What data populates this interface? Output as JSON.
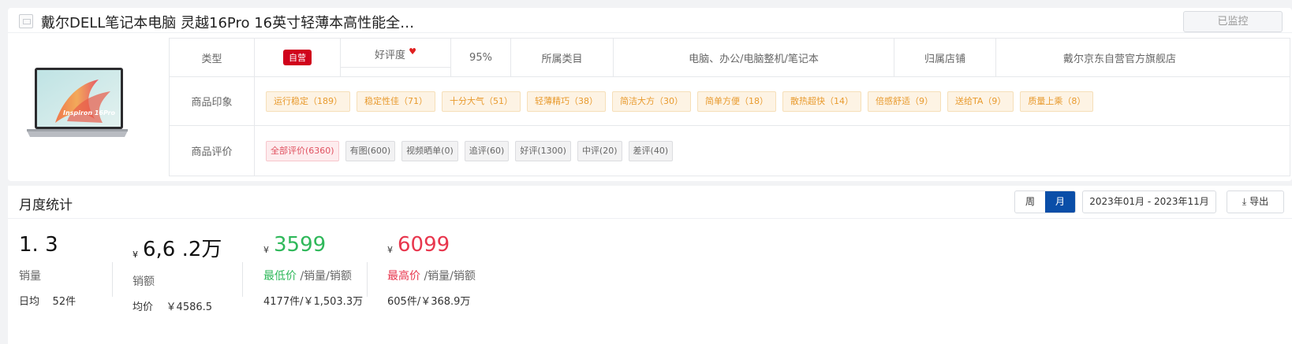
{
  "header": {
    "title": "戴尔DELL笔记本电脑 灵越16Pro 16英寸轻薄本高性能全…",
    "monitor_label": "已监控"
  },
  "product": {
    "image_text": "Inspiron 16Pro"
  },
  "info": {
    "type_label": "类型",
    "type_value": "自营",
    "rating_label": "好评度",
    "rating_value": "95%",
    "category_label": "所属类目",
    "category_value": "电脑、办公/电脑整机/笔记本",
    "store_label": "归属店铺",
    "store_value": "戴尔京东自营官方旗舰店",
    "impression_label": "商品印象",
    "impressions": [
      "运行稳定（189）",
      "稳定性佳（71）",
      "十分大气（51）",
      "轻薄精巧（38）",
      "简洁大方（30）",
      "简单方便（18）",
      "散热超快（14）",
      "倍感舒适（9）",
      "送给TA（9）",
      "质量上乘（8）"
    ],
    "comment_label": "商品评价",
    "comments": [
      "全部评价(6360)",
      "有图(600)",
      "视频晒单(0)",
      "追评(60)",
      "好评(1300)",
      "中评(20)",
      "差评(40)"
    ]
  },
  "monthly": {
    "title": "月度统计",
    "week_label": "周",
    "month_label": "月",
    "date_range": "2023年01月 - 2023年11月",
    "export_label": "导出",
    "sales": {
      "value": "1.  3",
      "label": "销量",
      "daily_label": "日均",
      "daily_value": "52件"
    },
    "revenue": {
      "currency": "¥",
      "value": "6,6    .2万",
      "label": "销额",
      "avg_label": "均价",
      "avg_value": "￥4586.5"
    },
    "lowest": {
      "currency": "¥",
      "value": "3599",
      "label_colored": "最低价",
      "label_rest": " /销量/销额",
      "detail": "4177件/￥1,503.3万"
    },
    "highest": {
      "currency": "¥",
      "value": "6099",
      "label_colored": "最高价",
      "label_rest": " /销量/销额",
      "detail": "605件/￥368.9万"
    }
  },
  "colors": {
    "accent": "#0a4ea8",
    "self_operated": "#d0021b",
    "green": "#2fb85a",
    "red": "#e8364d",
    "impression_tag": "#e89a2d"
  }
}
